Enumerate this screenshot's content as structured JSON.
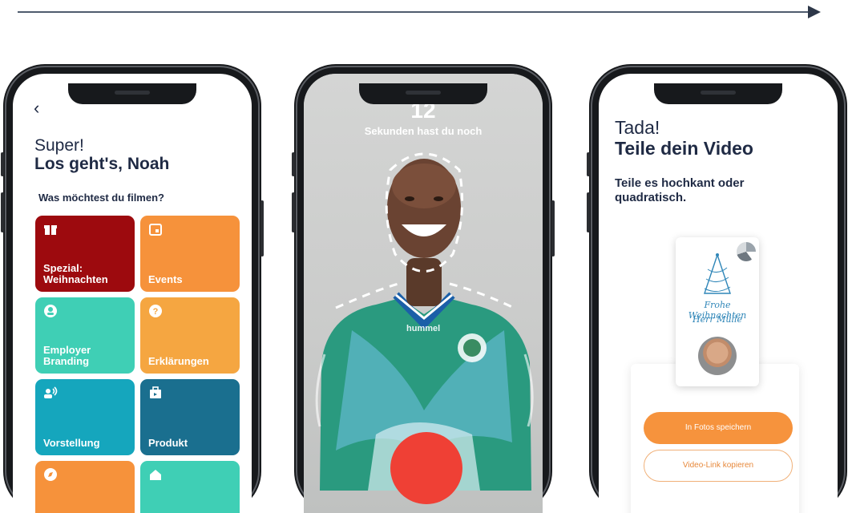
{
  "phone1": {
    "back_icon": "chevron-left-icon",
    "back_glyph": "‹",
    "greeting": "Super!",
    "title": "Los geht's, Noah",
    "question": "Was möchtest du filmen?",
    "tiles": [
      {
        "label": "Spezial: Weihnachten",
        "color": "#9d0a0e",
        "icon": "gift-icon",
        "glyph": "🎁"
      },
      {
        "label": "Events",
        "color": "#f6923b",
        "icon": "calendar-icon",
        "glyph": "▣"
      },
      {
        "label": "Employer Branding",
        "color": "#3fcfb5",
        "icon": "user-icon",
        "glyph": "●"
      },
      {
        "label": "Erklärungen",
        "color": "#f5a641",
        "icon": "help-icon",
        "glyph": "?"
      },
      {
        "label": "Vorstellung",
        "color": "#15a6bd",
        "icon": "speaker-icon",
        "glyph": "◉"
      },
      {
        "label": "Produkt",
        "color": "#1a6f8f",
        "icon": "product-box-icon",
        "glyph": "▣"
      },
      {
        "label": "",
        "color": "#f6923b",
        "icon": "compass-icon",
        "glyph": "◎"
      },
      {
        "label": "",
        "color": "#3fcfb5",
        "icon": "home-icon",
        "glyph": "⌂"
      }
    ]
  },
  "phone2": {
    "countdown": "12",
    "countdown_label": "Sekunden hast du noch",
    "jersey_text": "hummel"
  },
  "phone3": {
    "line1": "Tada!",
    "line2": "Teile dein Video",
    "subtitle": "Teile es hochkant oder quadratisch.",
    "card_line1": "Frohe Weihnachten",
    "card_line2": "Herr Mülle",
    "save_button": "In Fotos speichern",
    "copy_button": "Video-Link kopieren"
  }
}
